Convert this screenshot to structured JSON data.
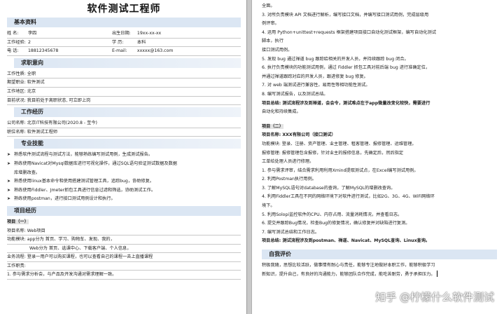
{
  "left": {
    "title": "软件测试工程师",
    "basic_header": "基本资料",
    "basic": {
      "name_label": "姓 名:",
      "name": "李四",
      "birth_label": "出生日期:",
      "birth": "19xx-xx-xx",
      "exp_label": "工作经验:",
      "exp": "2",
      "edu_label": "学 历:",
      "edu": "本科",
      "tel_label": "电 话:",
      "tel": "18812345678",
      "email_label": "E-mail:",
      "email": "xxxxx@163.com"
    },
    "intent_header": "求职意向",
    "intent": [
      "工作性质: 全职",
      "期望职业: 软件测试",
      "工作地区: 北京",
      "目前状况: 我目前处于离职状态, 可立即上岗"
    ],
    "work_header": "工作经历",
    "work": [
      "公司名称: 北京IT科技有限公司(2020.8 - 至今)",
      "职位名称: 软件测试工程师"
    ],
    "skills_header": "专业技能",
    "skills": [
      "熟悉软件测试流程与测试方法，能够熟练编写测试用例，生成测试报告。",
      "熟练使用Navicat对Mysql数据库进行可视化操作，通过SQL语句验证测试数据及数据",
      "库增删改查。",
      "熟悉使用linux基本命令和使用搭建测试管理工具，追踪bug，协助修复。",
      "熟练使用Fiddler、Jmeter抓包工具进行信息过滤和筛选，协助测试工作。",
      "熟练使用postman，进行接口测试用例设计和执行。"
    ],
    "projects_header": "项目经历",
    "project1_title": "项目（一）",
    "project1": [
      "项目名称: Web项目",
      "功能模块: app分为 首页、学习、购物车、发现、我的，",
      "Web分为 首页、选课中心、下载客户端、个人信息，",
      "业务流程: 登录一用户可以购买课程，也可以查看自己的课程一去上直播课程",
      "工作职责:",
      "1. 参与需求分析会，与产品及开发沟通对需求理解一致。"
    ]
  },
  "right": {
    "lines_top": [
      "全面。",
      "3. 对所负责模块 API 文档进行解析，编写接口文档，并编写接口测试用例，完成层级用",
      "例评审。",
      "4. 运用 Python+unittest+requests 框架搭建项目接口自动化测试框架，编写自动化测试",
      "脚本，执行",
      "接口测试用例。",
      "5. 发现 bug 通过禅道 bug 跟踪给相关的开发人员，并持续跟踪 bug 闭合。",
      "6. 执行负责模块的功能测试用例，通过 Fiddler 抓包工具对前后端 bug 进行准确定位，",
      "并通过禅道跟踪对应的开发人员，跟进修复 bug 修复。",
      "7. 对 web 端测试进行兼容性，易用性等相功能性测试。",
      "8. 编写测试报告，以及测试总结。",
      "项目总结: 测试流程涉及到禅道，会会令，测试难点在于app微量改变化较快，需要进行",
      "自动化和持续集成。"
    ],
    "project2_title": "项目（二）",
    "project2": [
      "项目名称: XXX有限公司（接口测试）",
      "功能模块: 登录、注册、资产管理、业主管理、租客管理、报修管理、运维管理。",
      "报修管理: 报修管理包含报修，针对业主的报修信息，先确定后，然后指定",
      "工单给处理人员进行修理。",
      "1. 参与需求评审，结合需求利用利用Xmind提取测试点，在Excel编写测试用例。",
      "2. 利用Postman执行用例。",
      "3. 了解MySQL语句对database的查询，了解MySQL的增删改查询。",
      "4. 利用Fiddler工具在不同的网络环境下对软件进行测试，比如2G、3G、4G、WiFi网络环",
      "境下。",
      "5. 利用Solopi监控软件的CPU、内存占用、流量消耗情况，并查看日志。",
      "6. 提交并跟踪Bug情况，检查Bug的修复情况，确认修复并对缺陷进行复测。",
      "7. 编写测试总结和工作日志。",
      "项目总结: 测试流程涉及到postman、禅道、Navicat、MySQL查询、Linux查询。"
    ],
    "self_header": "自我评价",
    "self": [
      "积极我随，思想比较活跃，做事情有耐心与责任，能够专注地做好本职工作，能够积极学习",
      "新知识，提升自己，有良好的沟通能力，能够团队合作完成，能吃苦耐劳，勇于承担压力。"
    ],
    "watermark": "知乎 @柠檬什么软件测试"
  }
}
